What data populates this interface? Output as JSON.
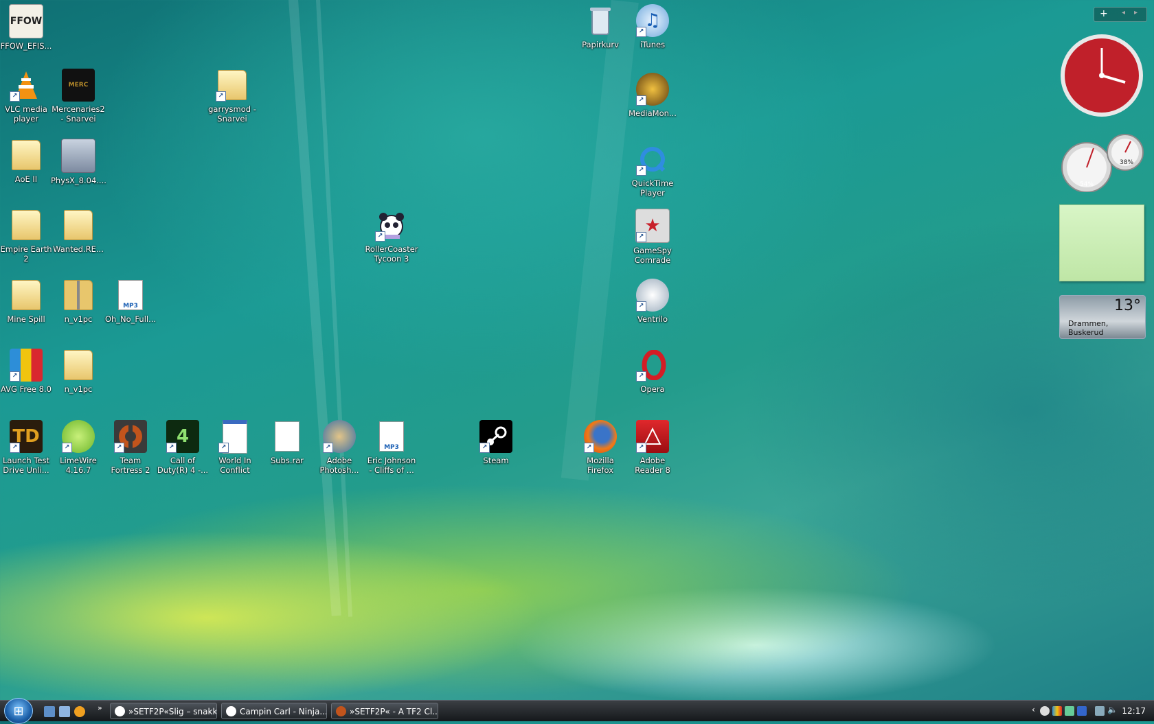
{
  "desktop": {
    "icons": {
      "ffow": "FFOW_EFIS...",
      "vlc": "VLC media\nplayer",
      "mercenaries": "Mercenaries2\n- Snarvei",
      "garrysmod": "garrysmod -\nSnarvei",
      "aoe": "AoE II",
      "physx": "PhysX_8.04....",
      "empire_earth": "Empire Earth\n2",
      "wanted": "Wanted.RE...",
      "mine_spill": "Mine Spill",
      "n_v1pc_zip": "n_v1pc",
      "oh_no": "Oh_No_Full...",
      "avg": "AVG Free 8.0",
      "n_v1pc_folder": "n_v1pc",
      "launch_test_drive": "Launch Test\nDrive Unli...",
      "limewire": "LimeWire\n4.16.7",
      "tf2": "Team\nFortress 2",
      "cod4": "Call of\nDuty(R) 4 -...",
      "world_in_conflict": "World In\nConflict",
      "subs": "Subs.rar",
      "photoshop": "Adobe\nPhotosh...",
      "eric_johnson": "Eric Johnson\n- Cliffs of ...",
      "rollercoaster": "RollerCoaster\nTycoon 3",
      "steam": "Steam",
      "papirkurv": "Papirkurv",
      "itunes": "iTunes",
      "mediamonkey": "MediaMon...",
      "quicktime": "QuickTime\nPlayer",
      "gamespy": "GameSpy\nComrade",
      "ventrilo": "Ventrilo",
      "opera": "Opera",
      "firefox": "Mozilla\nFirefox",
      "adobe_reader": "Adobe\nReader 8"
    }
  },
  "sidebar": {
    "cpu_percent": "54%",
    "mem_percent": "38%",
    "weather_temp": "13°",
    "weather_location": "Drammen, Buskerud"
  },
  "taskbar": {
    "buttons": [
      "»SETF2P«Slig – snakk",
      "Campin Carl - Ninja...",
      "»SETF2P« - A TF2 Cl..."
    ],
    "clock": "12:17"
  },
  "colors": {
    "folder": "#e8c66c",
    "clock_face": "#c0202a",
    "note": "#cdf0b8"
  }
}
